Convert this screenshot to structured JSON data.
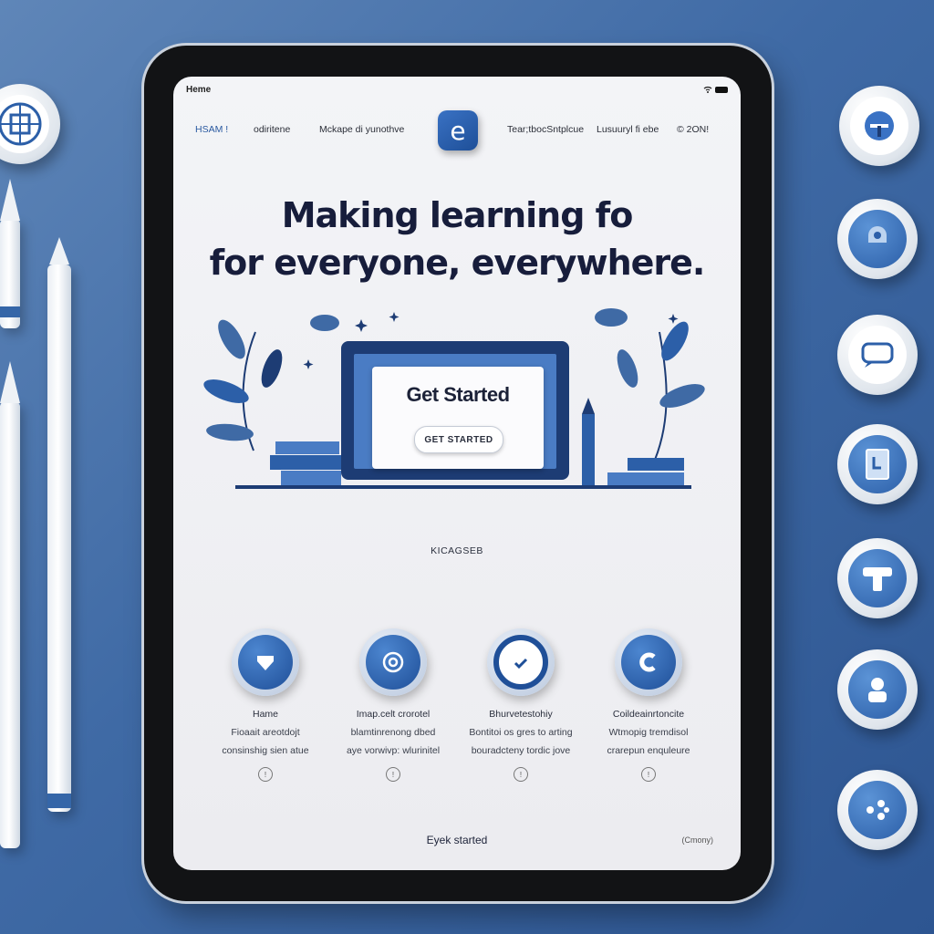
{
  "statusbar": {
    "title": "Heme"
  },
  "nav": {
    "items": [
      "HSAM !",
      "odiritene",
      "Mckape di yunothve",
      "Tear;tbocSntplcue",
      "Lusuuryl fi ebe",
      "© 2ON!"
    ],
    "logo_glyph": "e"
  },
  "hero": {
    "headline_line1": "Making learning fo",
    "headline_line2": "for everyone, everywhere."
  },
  "illustration": {
    "card_title": "Get Started",
    "card_button": "GET STARTED"
  },
  "section_label": "KICAGSEB",
  "features": [
    {
      "icon": "shield-arrow-icon",
      "title": "Hame",
      "lines": [
        "Fioaait areotdojt",
        "consinshig sien atue"
      ]
    },
    {
      "icon": "at-sign-icon",
      "title": "Imap.celt crorotel",
      "lines": [
        "blamtinrenong dbed",
        "aye vorwivp: wlurinitel"
      ]
    },
    {
      "icon": "checkmark-icon",
      "title": "Bhurvetestohiy",
      "lines": [
        "Bontitoi os gres to arting",
        "bouradcteny tordic jove"
      ]
    },
    {
      "icon": "c-icon",
      "title": "Coildeainrtoncite",
      "lines": [
        "Wtmopig tremdisol",
        "crarepun enquleure"
      ]
    }
  ],
  "footer": {
    "center": "Eyek started",
    "right": "(Cmony)"
  },
  "colors": {
    "primary": "#1f4f98",
    "accent": "#4a7cc4",
    "headline": "#171d3b",
    "background": "#3f6aa5"
  }
}
